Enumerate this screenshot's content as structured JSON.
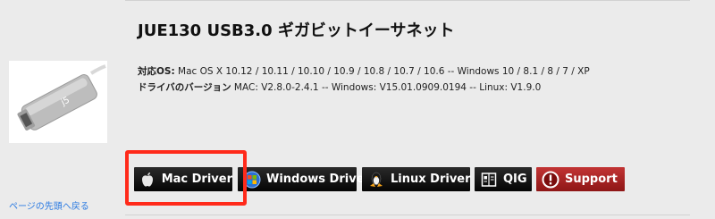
{
  "product": {
    "title": "JUE130 USB3.0 ギガビットイーサネット",
    "os_label": "対応OS:",
    "os_value": " Mac OS X 10.12 / 10.11 / 10.10 / 10.9 / 10.8 / 10.7 / 10.6 -- Windows 10 / 8.1 / 8 / 7 / XP",
    "driver_version_label": "ドライバのバージョン",
    "driver_version_value": " MAC: V2.8.0-2.4.1 -- Windows: V15.01.0909.0194 -- Linux: V1.9.0",
    "image_alt_logo": "j5"
  },
  "buttons": {
    "mac_driver": "Mac Driver",
    "windows_driver": "Windows Driver",
    "linux_driver": "Linux Driver",
    "qig": "QIG",
    "support": "Support"
  },
  "icons": {
    "mac_driver": "apple-icon",
    "windows_driver": "windows-globe-icon",
    "linux_driver": "linux-penguin-icon",
    "qig": "document-icon",
    "support": "alert-icon"
  },
  "links": {
    "back_to_top": "ページの先頭へ戻る"
  },
  "colors": {
    "page_background": "#ebebeb",
    "button_dark": "#111111",
    "support_red": "#a91f1f",
    "highlight_red": "#ff2a1a",
    "link_blue": "#2a7ae2"
  }
}
